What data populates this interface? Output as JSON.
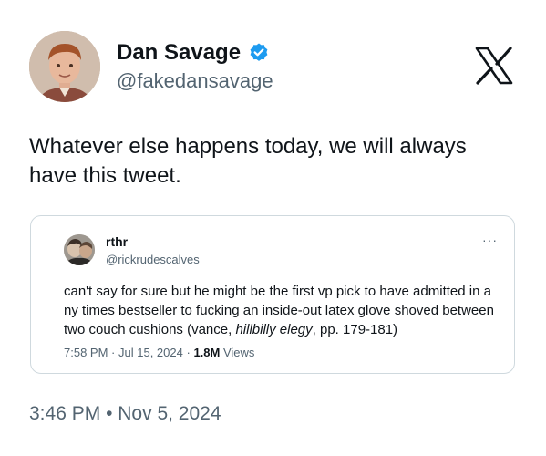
{
  "author": {
    "name": "Dan Savage",
    "handle": "@fakedansavage",
    "verified_icon": "verified-badge-icon",
    "brand_logo": "x-logo-icon"
  },
  "tweet": {
    "text": "Whatever else happens today, we will always have this tweet.",
    "timestamp": "3:46 PM",
    "separator": "•",
    "date": "Nov 5, 2024"
  },
  "quoted": {
    "name": "rthr",
    "handle": "@rickrudescalves",
    "more_label": "···",
    "text_before": "can't say for sure but he might be the first vp pick to have admitted in a ny times bestseller to fucking an inside-out latex glove shoved between two couch cushions (vance, ",
    "text_italic": "hillbilly elegy",
    "text_after": ", pp. 179-181)",
    "time": "7:58 PM",
    "dot1": "·",
    "date": "Jul 15, 2024",
    "dot2": "·",
    "views_count": "1.8M",
    "views_label": "Views"
  },
  "colors": {
    "primary_text": "#0f1419",
    "secondary_text": "#536471",
    "verified_blue": "#1d9bf0",
    "border": "#cfd9de"
  }
}
